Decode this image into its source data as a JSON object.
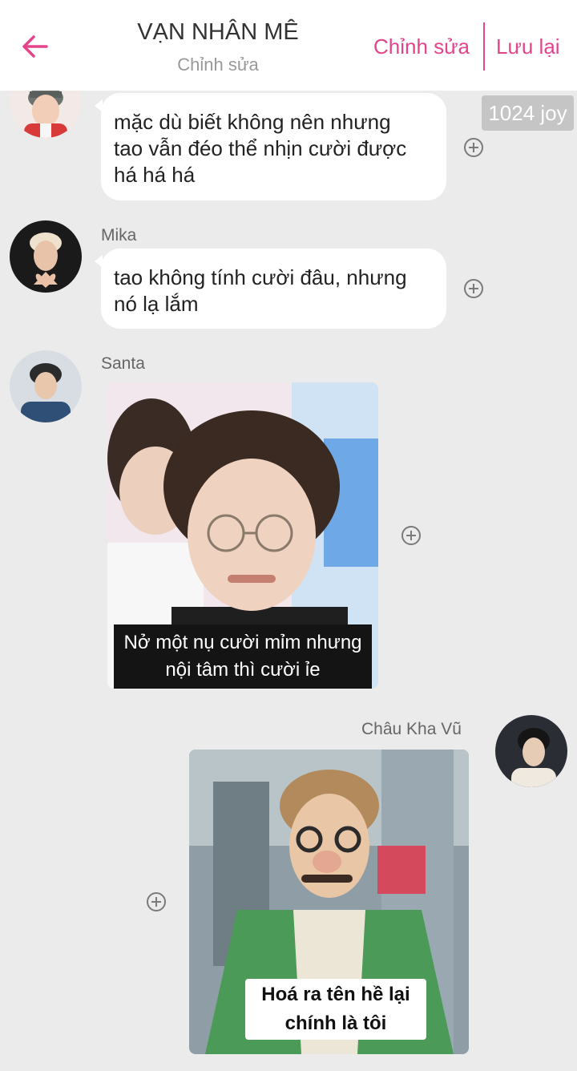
{
  "header": {
    "title": "VẠN NHÂN MÊ",
    "subtitle": "Chỉnh sửa",
    "edit_label": "Chỉnh sửa",
    "save_label": "Lưu lại",
    "accent_color": "#e4448a",
    "back_icon": "arrow-left-icon"
  },
  "messages": [
    {
      "sender": "",
      "lines": [
        "mặc dù biết không nên nhưng",
        "tao vẫn đéo thể nhịn cười được",
        "há há há"
      ]
    },
    {
      "sender": "Mika",
      "lines": [
        "tao không tính cười đâu, nhưng",
        "nó lạ lắm"
      ]
    },
    {
      "sender": "Santa",
      "image_caption": [
        "Nở một nụ cười mỉm nhưng",
        "nội tâm thì cười ỉe"
      ]
    },
    {
      "sender": "Châu Kha Vũ",
      "image_caption": [
        "Hoá ra tên hề lại",
        "chính là tôi"
      ]
    }
  ],
  "badge": {
    "text": "1024 joy"
  },
  "icons": {
    "add": "plus-circle-icon"
  }
}
